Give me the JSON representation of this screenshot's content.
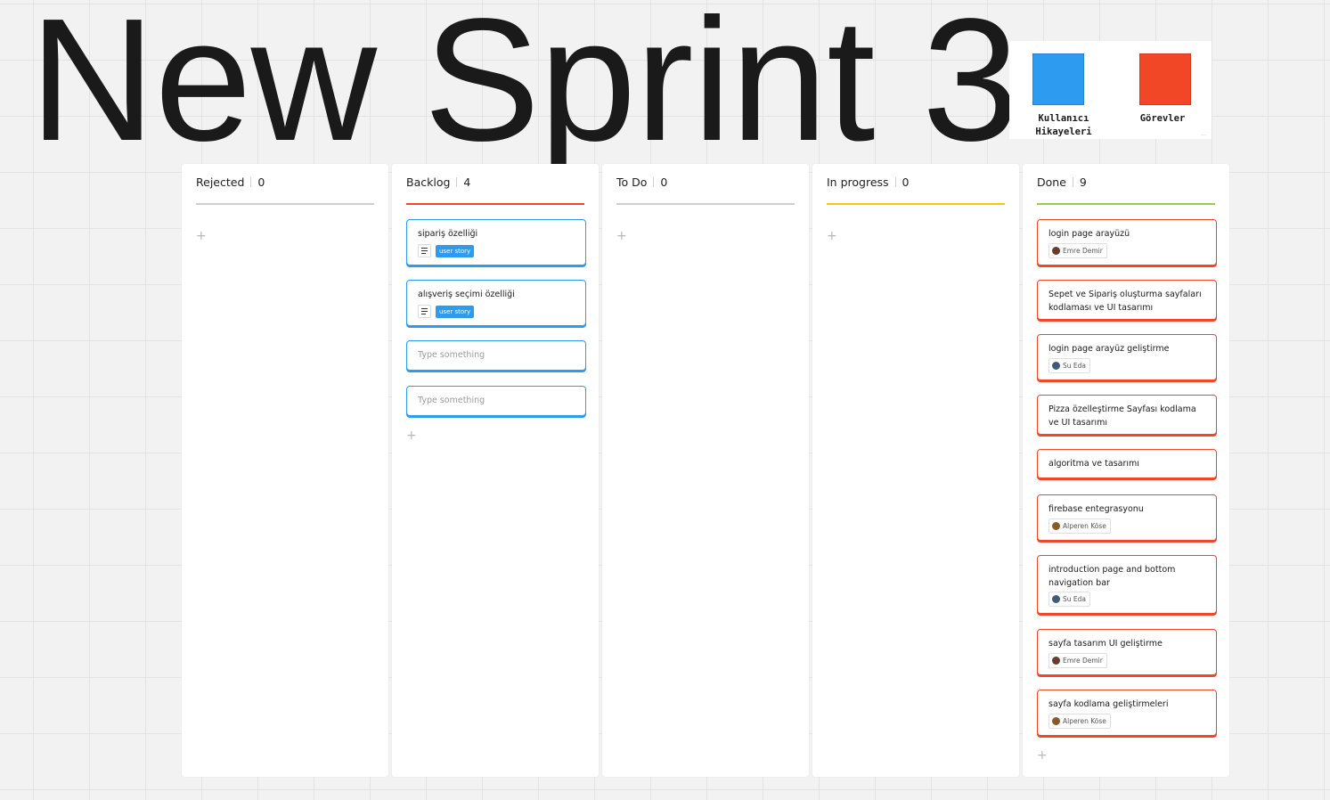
{
  "board": {
    "title": "New Sprint 3"
  },
  "legend": {
    "items": [
      {
        "label": "Kullanıcı\nHikayeleri",
        "color": "#2d9bf0"
      },
      {
        "label": "Görevler",
        "color": "#f24726"
      }
    ],
    "more": "..."
  },
  "columns": [
    {
      "title": "Rejected",
      "count": "0",
      "line_color": "#cfcfcf",
      "add": "+"
    },
    {
      "title": "Backlog",
      "count": "4",
      "line_color": "#f24726",
      "add": "+",
      "cards": [
        {
          "text": "sipariş özelliği",
          "tag": "user story",
          "icon": "document-lines-icon"
        },
        {
          "text": "alışveriş seçimi özelliği",
          "tag": "user story",
          "icon": "document-lines-icon"
        },
        {
          "placeholder": "Type something"
        },
        {
          "placeholder": "Type something"
        }
      ]
    },
    {
      "title": "To Do",
      "count": "0",
      "line_color": "#cfcfcf",
      "add": "+"
    },
    {
      "title": "In progress",
      "count": "0",
      "line_color": "#fac710",
      "add": "+"
    },
    {
      "title": "Done",
      "count": "9",
      "line_color": "#8fd14f",
      "add": "+",
      "cards": [
        {
          "text": "login page arayüzü",
          "assignee": "Emre Demir"
        },
        {
          "text": "Sepet ve Sipariş oluşturma sayfaları kodlaması ve UI tasarımı"
        },
        {
          "text": "login page arayüz geliştirme",
          "assignee": "Su Eda"
        },
        {
          "text": "Pizza özelleştirme Sayfası kodlama ve UI tasarımı"
        },
        {
          "text": "algoritma ve tasarımı"
        },
        {
          "text": "firebase entegrasyonu",
          "assignee": "Alperen Köse"
        },
        {
          "text": "introduction page and bottom navigation bar",
          "assignee": "Su Eda"
        },
        {
          "text": "sayfa tasarım UI geliştirme",
          "assignee": "Emre Demir"
        },
        {
          "text": "sayfa kodlama geliştirmeleri",
          "assignee": "Alperen Köse"
        }
      ]
    }
  ],
  "colors": {
    "user_story": "#2d9bf0",
    "task": "#f24726"
  }
}
